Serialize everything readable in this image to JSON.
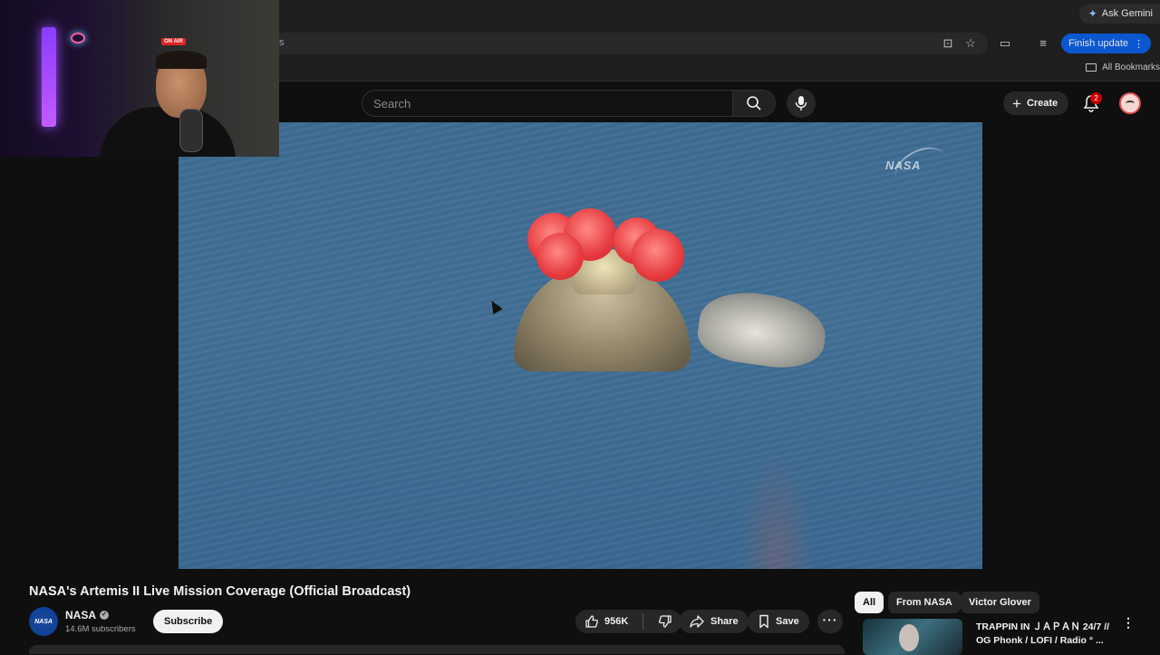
{
  "browser": {
    "ask_gemini": "Ask Gemini",
    "url_tail": "s",
    "finish_update": "Finish update",
    "all_bookmarks": "All Bookmarks"
  },
  "header": {
    "search_placeholder": "Search",
    "create_label": "Create",
    "notification_count": "2"
  },
  "webcam": {
    "on_air": "ON AIR"
  },
  "player": {
    "watermark": "NASA"
  },
  "video": {
    "title": "NASA's Artemis II Live Mission Coverage (Official Broadcast)",
    "channel": {
      "name": "NASA",
      "avatar_text": "NASA",
      "subscribers": "14.6M subscribers"
    },
    "subscribe_label": "Subscribe",
    "likes": "956K",
    "share_label": "Share",
    "save_label": "Save",
    "more_label": "···"
  },
  "sidebar": {
    "chips": [
      {
        "label": "All",
        "active": true
      },
      {
        "label": "From NASA",
        "active": false
      },
      {
        "label": "Victor Glover",
        "active": false
      }
    ],
    "recommendation": {
      "title": "TRAPPIN IN ＪＡＰＡＮ 24/7 // OG Phonk / LOFI / Radio ° ..."
    }
  },
  "colors": {
    "accent_blue": "#0b57d0",
    "notification_red": "#cc0000",
    "background": "#0f0f0f"
  }
}
